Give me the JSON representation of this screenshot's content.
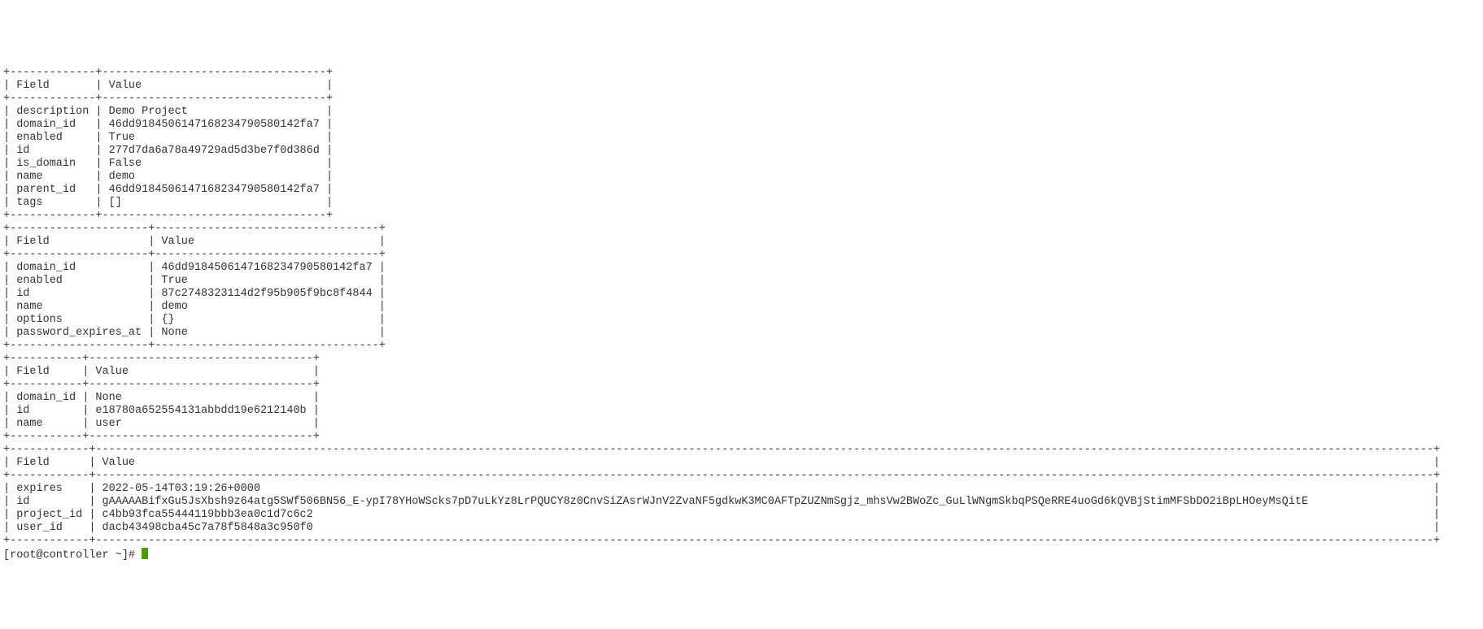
{
  "tables": [
    {
      "header": {
        "field": "Field",
        "value": "Value"
      },
      "col1_width": 13,
      "col2_width": 34,
      "rows": [
        {
          "field": "description",
          "value": "Demo Project"
        },
        {
          "field": "domain_id",
          "value": "46dd918450614716823479058014 2fa7"
        },
        {
          "field": "enabled",
          "value": "True"
        },
        {
          "field": "id",
          "value": "277d7da6a78a49729ad5d3be7f0d386d"
        },
        {
          "field": "is_domain",
          "value": "False"
        },
        {
          "field": "name",
          "value": "demo"
        },
        {
          "field": "parent_id",
          "value": "46dd918450614716823479058014 2fa7"
        },
        {
          "field": "tags",
          "value": "[]"
        }
      ]
    },
    {
      "header": {
        "field": "Field",
        "value": "Value"
      },
      "col1_width": 21,
      "col2_width": 34,
      "rows": [
        {
          "field": "domain_id",
          "value": "46dd918450614716823479058014 2fa7"
        },
        {
          "field": "enabled",
          "value": "True"
        },
        {
          "field": "id",
          "value": "87c2748323114d2f95b905f9bc8f4844"
        },
        {
          "field": "name",
          "value": "demo"
        },
        {
          "field": "options",
          "value": "{}"
        },
        {
          "field": "password_expires_at",
          "value": "None"
        }
      ]
    },
    {
      "header": {
        "field": "Field",
        "value": "Value"
      },
      "col1_width": 11,
      "col2_width": 34,
      "rows": [
        {
          "field": "domain_id",
          "value": "None"
        },
        {
          "field": "id",
          "value": "e18780a652554131abbdd19e6212140b"
        },
        {
          "field": "name",
          "value": "user"
        }
      ]
    },
    {
      "header": {
        "field": "Field",
        "value": "Value"
      },
      "col1_width": 12,
      "col2_width": 203,
      "rows": [
        {
          "field": "expires",
          "value": "2022-05-14T03:19:26+0000"
        },
        {
          "field": "id",
          "value": "gAAAAABifxGu5JsXbsh9z64atg5SWf506BN56_E-ypI78YHoWScks7pD7uLkYz8LrPQUCY8z0CnvSiZAsrWJnV2ZvaNF5gdkwK3MC0AFTpZUZNmSgjz_mhsVw2BWoZc_GuLlWNgmSkbqPSQeRRE4uoGd6kQVBjStimMFSbDO2iBpLHOeyMsQitE"
        },
        {
          "field": "project_id",
          "value": "c4bb93fca55444119bbb3ea0c1d7c6c2"
        },
        {
          "field": "user_id",
          "value": "dacb43498cba45c7a78f5848a3c950f0"
        }
      ],
      "no_bottom_border": true
    }
  ],
  "prompt": "[root@controller ~]# "
}
